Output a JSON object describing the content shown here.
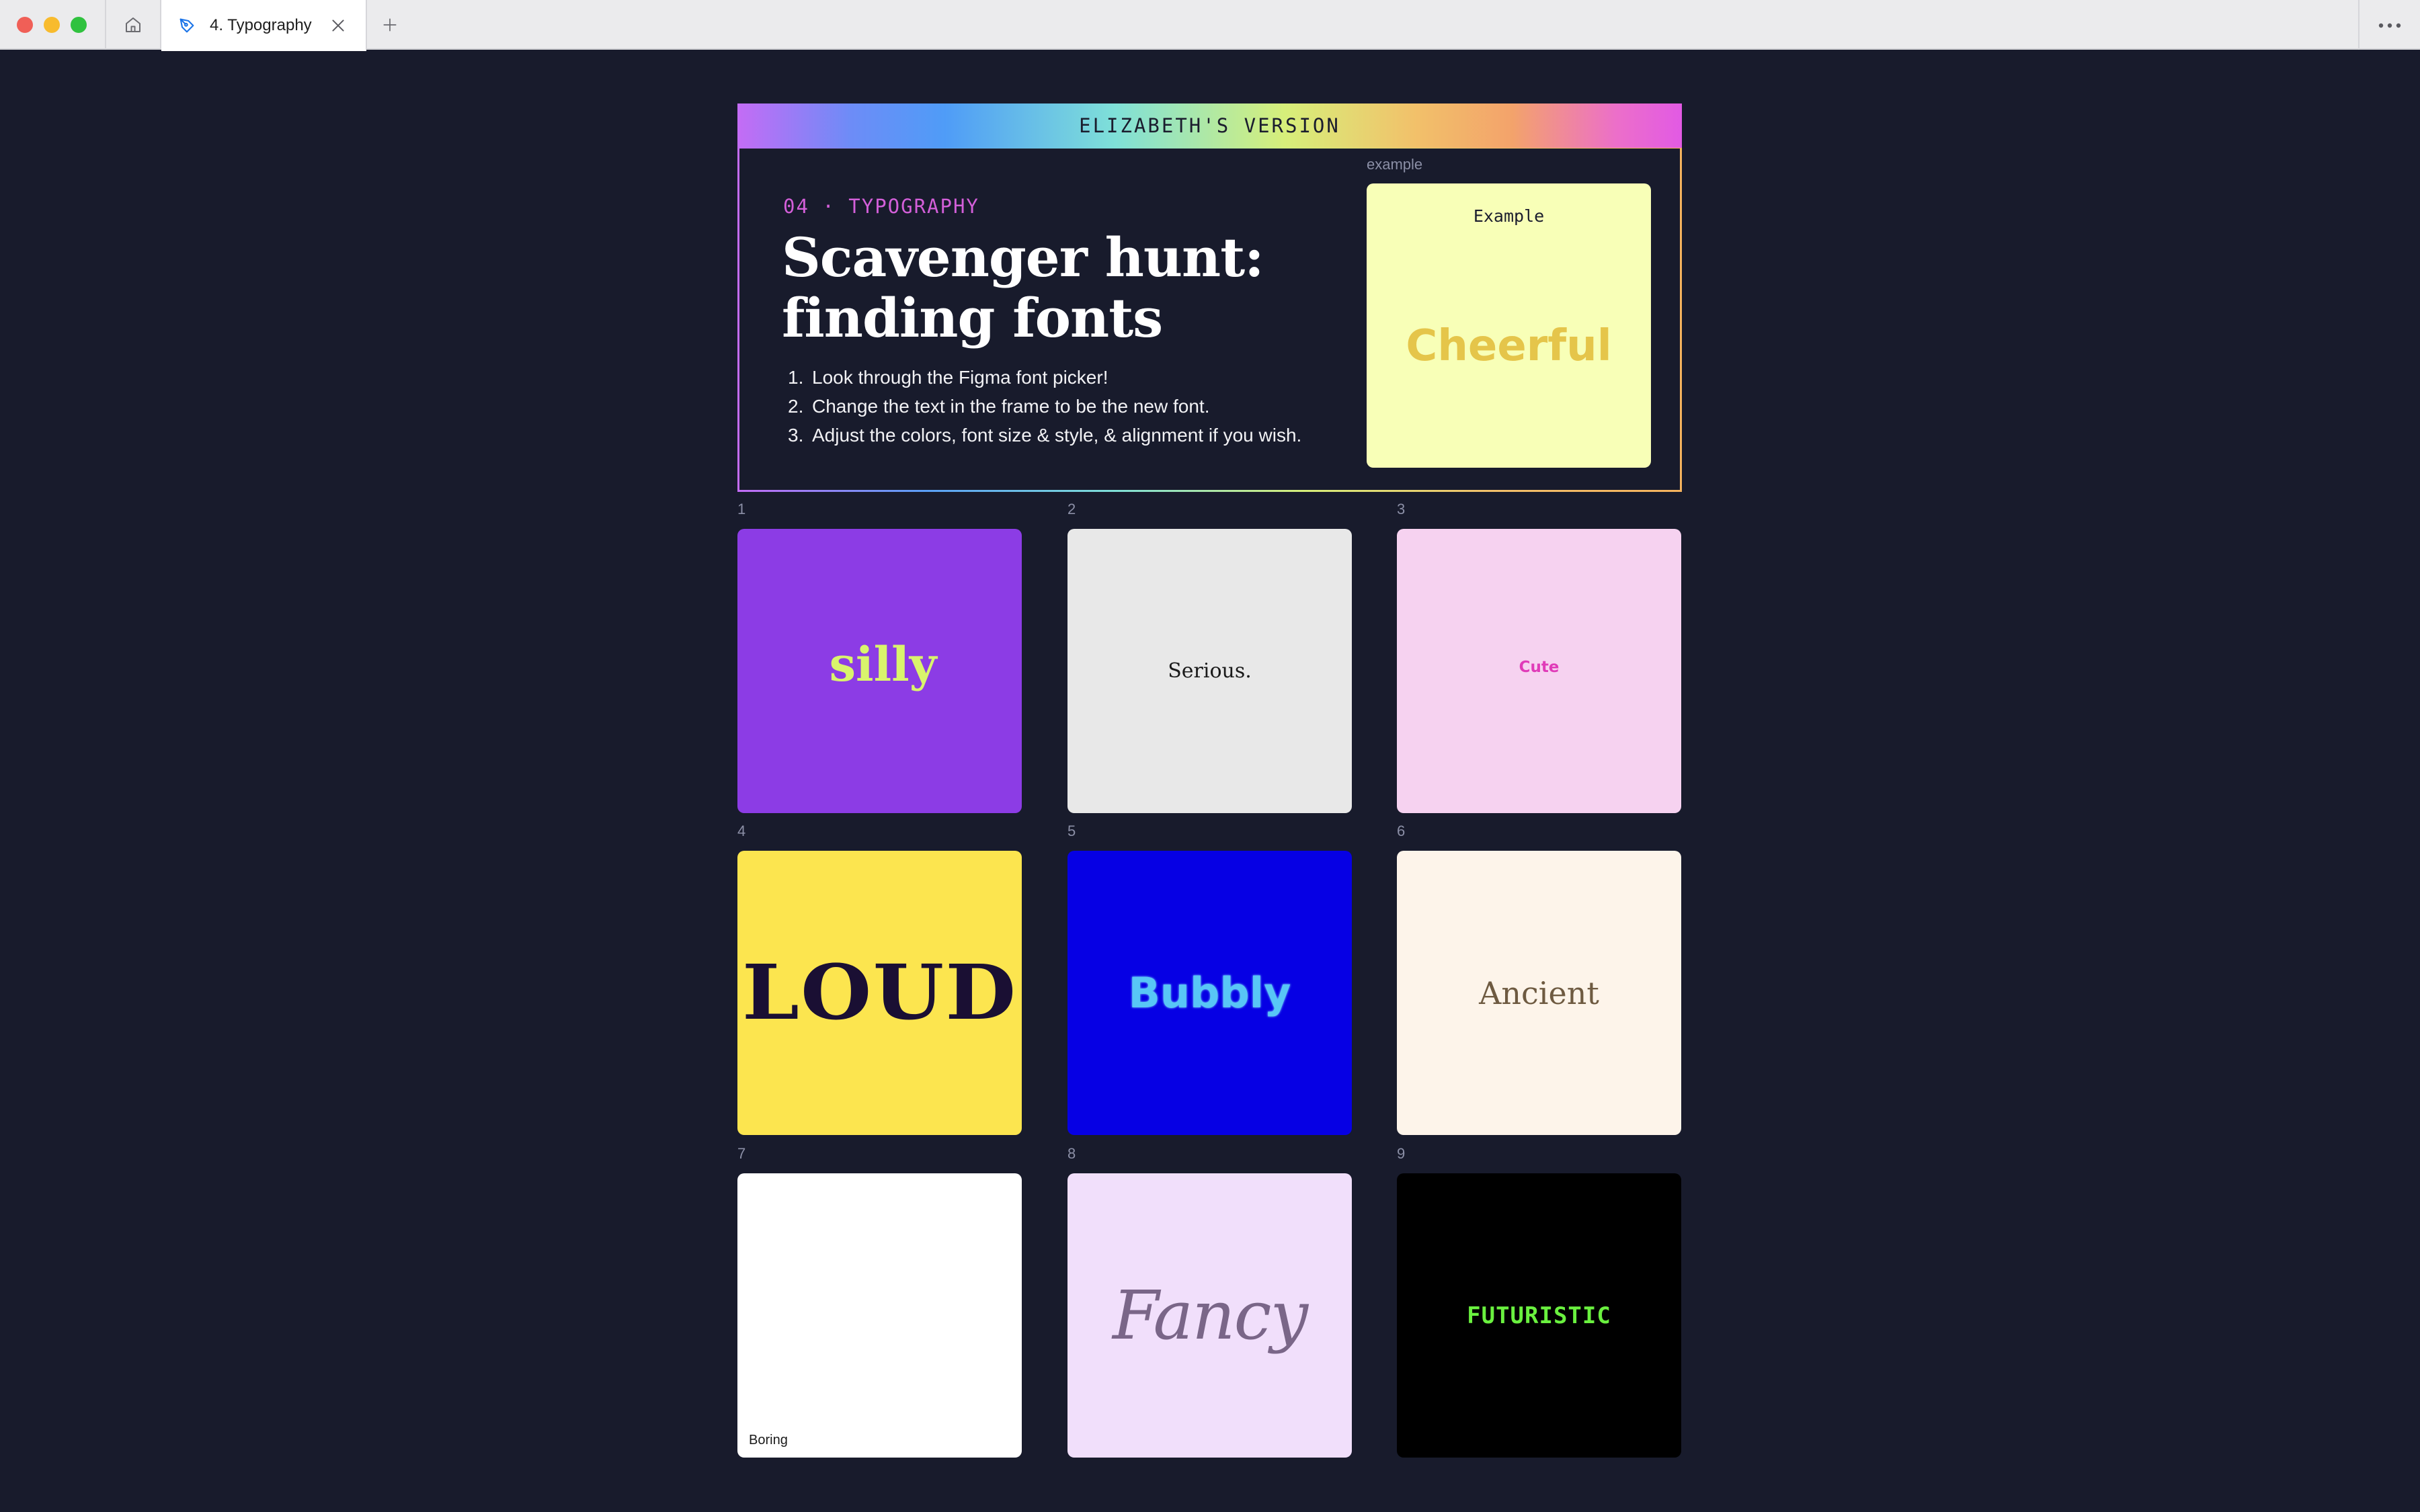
{
  "window": {
    "tab_title": "4. Typography"
  },
  "header": {
    "banner": "ELIZABETH'S VERSION",
    "eyebrow": "04 · TYPOGRAPHY",
    "title_line1": "Scavenger hunt:",
    "title_line2": "finding fonts",
    "steps": [
      {
        "num": "1.",
        "text": "Look through the Figma font picker!"
      },
      {
        "num": "2.",
        "text": "Change the text in the frame to be the new font."
      },
      {
        "num": "3.",
        "text": "Adjust the colors, font size & style, & alignment if you wish."
      }
    ],
    "example_label": "example",
    "example_caption": "Example",
    "example_word": "Cheerful"
  },
  "cards": [
    {
      "num": "1",
      "word": "silly",
      "bg": "#8c3ce5",
      "color": "#d9f46c"
    },
    {
      "num": "2",
      "word": "Serious.",
      "bg": "#e8e8e8",
      "color": "#1a1a1a"
    },
    {
      "num": "3",
      "word": "Cute",
      "bg": "#f6d2f0",
      "color": "#e03bb8"
    },
    {
      "num": "4",
      "word": "LOUD",
      "bg": "#fce54f",
      "color": "#1a0f33"
    },
    {
      "num": "5",
      "word": "Bubbly",
      "bg": "#0600e4",
      "color": "#58c6f6"
    },
    {
      "num": "6",
      "word": "Ancient",
      "bg": "#fdf4ea",
      "color": "#6e5a41"
    },
    {
      "num": "7",
      "word": "Boring",
      "bg": "#ffffff",
      "color": "#1a1a1a"
    },
    {
      "num": "8",
      "word": "Fancy",
      "bg": "#f1dffb",
      "color": "#7a6688"
    },
    {
      "num": "9",
      "word": "FUTURISTIC",
      "bg": "#000000",
      "color": "#6af13f"
    }
  ],
  "colors": {
    "canvas": "#181b2c",
    "accent_eyebrow": "#d35fd9"
  }
}
